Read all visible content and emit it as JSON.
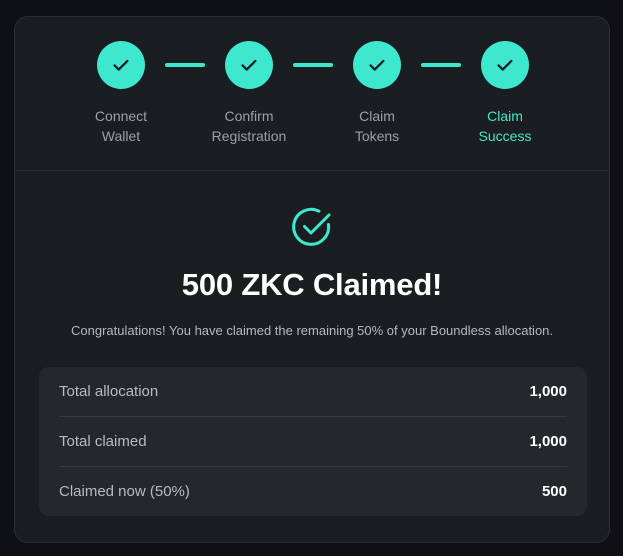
{
  "steps": [
    {
      "label": "Connect\nWallet",
      "status": "complete",
      "icon": "check-icon"
    },
    {
      "label": "Confirm\nRegistration",
      "status": "complete",
      "icon": "check-icon"
    },
    {
      "label": "Claim\nTokens",
      "status": "complete",
      "icon": "check-icon"
    },
    {
      "label": "Claim\nSuccess",
      "status": "active",
      "icon": "check-icon"
    }
  ],
  "success": {
    "icon": "check-circle-icon",
    "headline": "500 ZKC Claimed!",
    "message": "Congratulations! You have claimed the remaining 50% of your Boundless allocation."
  },
  "summary": {
    "rows": [
      {
        "label": "Total allocation",
        "value": "1,000"
      },
      {
        "label": "Total claimed",
        "value": "1,000"
      },
      {
        "label": "Claimed now (50%)",
        "value": "500"
      }
    ]
  },
  "colors": {
    "accent": "#3ee8cf",
    "card_background": "#1b1e21",
    "page_background": "#0e1013",
    "summary_background": "#24282c"
  }
}
